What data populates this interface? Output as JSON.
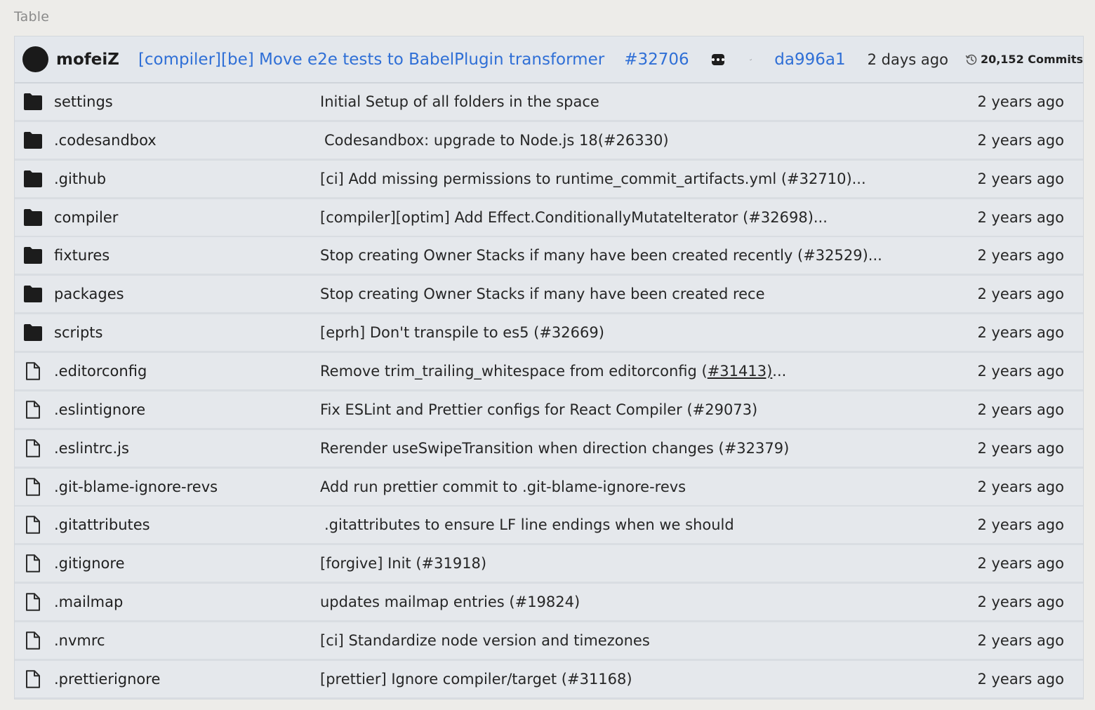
{
  "section_label": "Table",
  "header": {
    "author": "mofeiZ",
    "commit_message": "[compiler][be] Move e2e tests to BabelPlugin transformer",
    "pr": "#32706",
    "sha": "da996a1",
    "when": "2 days ago",
    "commits_label": "20,152 Commits",
    "icons": [
      "avatar",
      "more-dots-icon",
      "check-icon",
      "history-icon"
    ]
  },
  "rows": [
    {
      "type": "folder",
      "name": "settings",
      "message": "Initial Setup of all folders in the space",
      "age": "2 years ago"
    },
    {
      "type": "folder",
      "name": ".codesandbox",
      "message": "Codesandbox: upgrade to Node.js 18(#26330)",
      "age": "2 years ago"
    },
    {
      "type": "folder",
      "name": ".github",
      "message": "[ci] Add missing permissions to runtime_commit_artifacts.yml (#32710)...",
      "age": "2 years ago"
    },
    {
      "type": "folder",
      "name": "compiler",
      "message": "[compiler][optim] Add Effect.ConditionallyMutateIterator (#32698)...",
      "age": "2 years ago"
    },
    {
      "type": "folder",
      "name": "fixtures",
      "message": "Stop creating Owner Stacks if many have been created recently (#32529)...",
      "age": "2 years ago"
    },
    {
      "type": "folder",
      "name": "packages",
      "message": "Stop creating Owner Stacks if many have been created rece",
      "age": "2 years ago"
    },
    {
      "type": "folder",
      "name": "scripts",
      "message": "[eprh] Don't transpile to es5 (#32669)",
      "age": "2 years ago"
    },
    {
      "type": "file",
      "name": ".editorconfig",
      "message_pre": "Remove trim_trailing_whitespace from editorconfig (",
      "message_link": "#31413)",
      "message_post": "...",
      "age": "2 years ago"
    },
    {
      "type": "file",
      "name": ".eslintignore",
      "message": "Fix ESLint and Prettier configs for React Compiler (#29073)",
      "age": "2 years ago"
    },
    {
      "type": "file",
      "name": ".eslintrc.js",
      "message": "Rerender useSwipeTransition when direction changes (#32379)",
      "age": "2 years ago"
    },
    {
      "type": "file",
      "name": ".git-blame-ignore-revs",
      "message": "Add run prettier commit to .git-blame-ignore-revs",
      "age": "2 years ago"
    },
    {
      "type": "file",
      "name": ".gitattributes",
      "message": ".gitattributes to ensure LF line endings when we should",
      "age": "2 years ago"
    },
    {
      "type": "file",
      "name": ".gitignore",
      "message": "[forgive] Init (#31918)",
      "age": "2 years ago"
    },
    {
      "type": "file",
      "name": ".mailmap",
      "message": "updates mailmap entries (#19824)",
      "age": "2 years ago"
    },
    {
      "type": "file",
      "name": ".nvmrc",
      "message": "[ci] Standardize node version and timezones",
      "age": "2 years ago"
    },
    {
      "type": "file",
      "name": ".prettierignore",
      "message": "[prettier] Ignore compiler/target (#31168)",
      "age": "2 years ago"
    }
  ],
  "colors": {
    "link": "#2f6fd6",
    "row_bg": "#e5e8ec",
    "header_bg": "#e3e7ec",
    "page_bg": "#edece9"
  }
}
